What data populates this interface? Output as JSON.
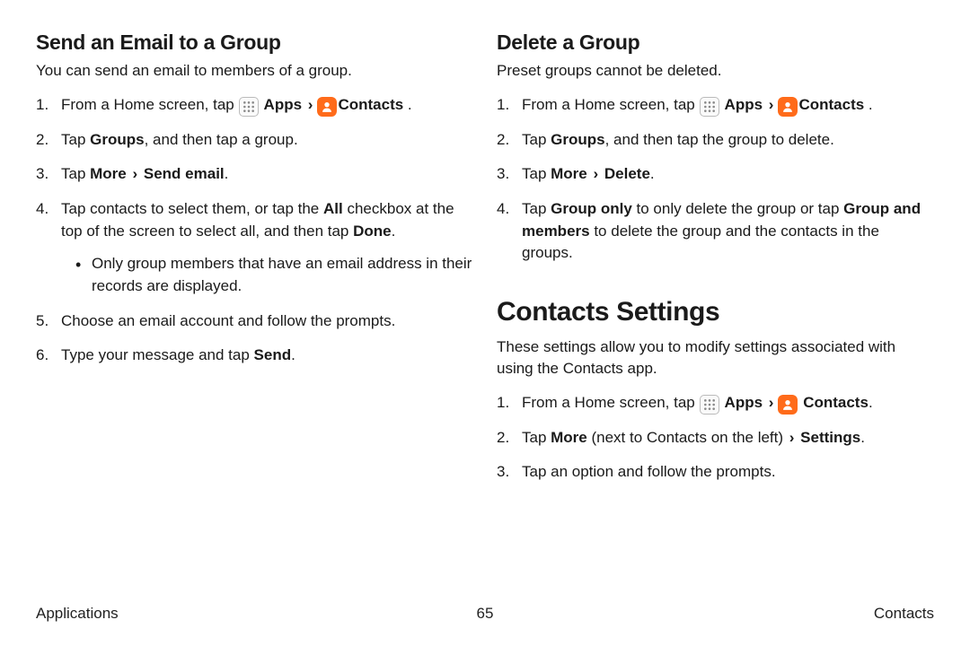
{
  "left": {
    "heading": "Send an Email to a Group",
    "intro": "You can send an email to members of a group.",
    "step1_a": "From a Home screen, tap ",
    "step1_apps": " Apps ",
    "step1_contacts": "Contacts",
    "step1_end": " .",
    "step2_a": "Tap ",
    "step2_b": "Groups",
    "step2_c": ", and then tap a group.",
    "step3_a": "Tap ",
    "step3_b": "More ",
    "step3_c": " Send email",
    "step3_d": ".",
    "step4_a": "Tap contacts to select them, or tap the ",
    "step4_b": "All",
    "step4_c": " checkbox at the top of the screen to select all, and then tap ",
    "step4_d": "Done",
    "step4_e": ".",
    "sub1": "Only group members that have an email address in their records are displayed.",
    "step5": "Choose an email account and follow the prompts.",
    "step6_a": "Type your message and tap ",
    "step6_b": "Send",
    "step6_c": "."
  },
  "right": {
    "heading": "Delete a Group",
    "intro": "Preset groups cannot be deleted.",
    "step1_a": "From a Home screen, tap ",
    "step1_apps": " Apps ",
    "step1_contacts": "Contacts",
    "step1_end": " .",
    "step2_a": "Tap ",
    "step2_b": "Groups",
    "step2_c": ", and then tap the group to delete.",
    "step3_a": "Tap ",
    "step3_b": "More ",
    "step3_c": " Delete",
    "step3_d": ".",
    "step4_a": "Tap ",
    "step4_b": "Group only",
    "step4_c": " to only delete the group or tap ",
    "step4_d": "Group and members",
    "step4_e": " to delete the group and the contacts in the groups.",
    "big": "Contacts Settings",
    "intro2": "These settings allow you to modify settings associated with using the Contacts app.",
    "c_step1_a": "From a Home screen, tap ",
    "c_step1_apps": " Apps ",
    "c_step1_contacts": " Contacts",
    "c_step1_end": ".",
    "c_step2_a": "Tap ",
    "c_step2_b": "More",
    "c_step2_c": " (next to Contacts on the left) ",
    "c_step2_d": " Settings",
    "c_step2_e": ".",
    "c_step3": "Tap an option and follow the prompts."
  },
  "footer": {
    "left": "Applications",
    "center": "65",
    "right": "Contacts"
  },
  "chev": "›"
}
